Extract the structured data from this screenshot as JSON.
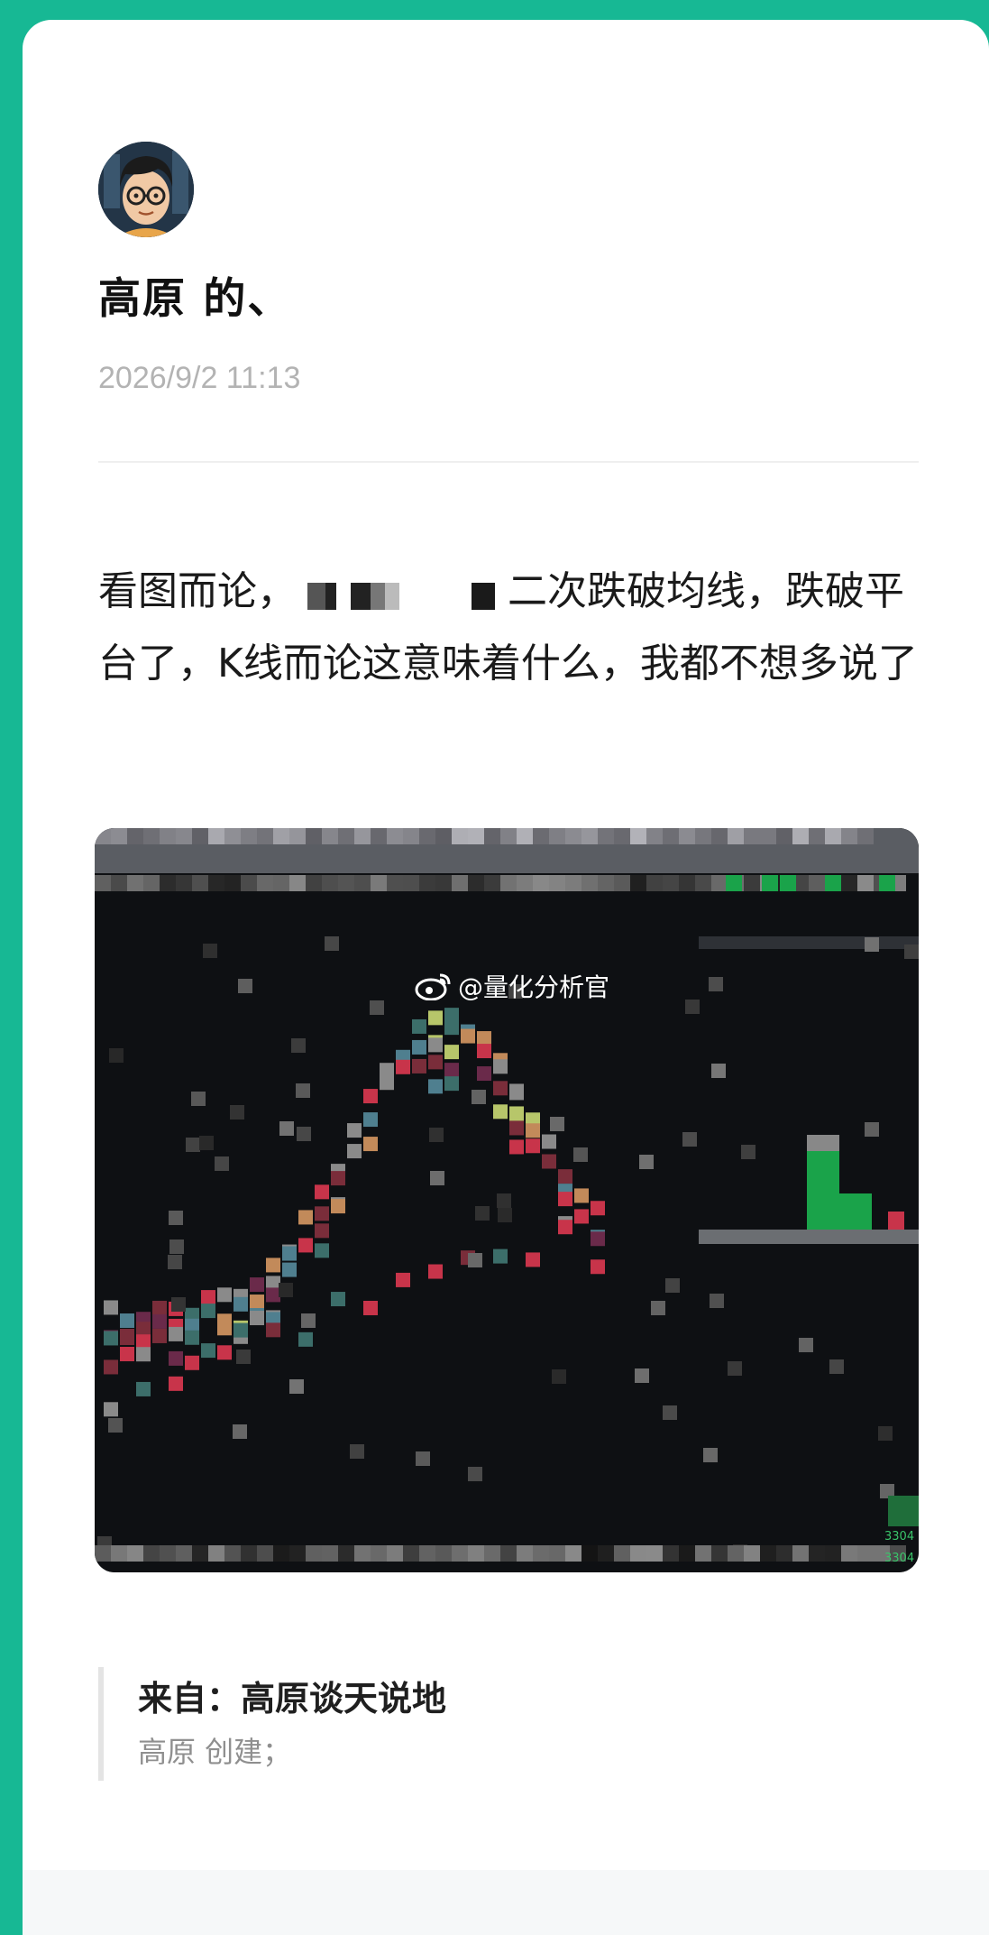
{
  "post": {
    "author": "高原 的、",
    "timestamp": "2026/9/2 11:13",
    "text_before": "看图而论，",
    "text_after": "二次跌破均线，跌破平台了，K线而论这意味着什么，我都不想多说了"
  },
  "figure": {
    "watermark": "@量化分析官",
    "price_label_1": "3304",
    "price_label_2": "3304"
  },
  "source": {
    "title": "来自：高原谈天说地",
    "subtitle": "高原 创建；"
  },
  "colors": {
    "background": "#17b894",
    "card": "#ffffff",
    "chart_bg": "#0e1013",
    "up": "#c8344a",
    "down": "#1aa34a"
  }
}
